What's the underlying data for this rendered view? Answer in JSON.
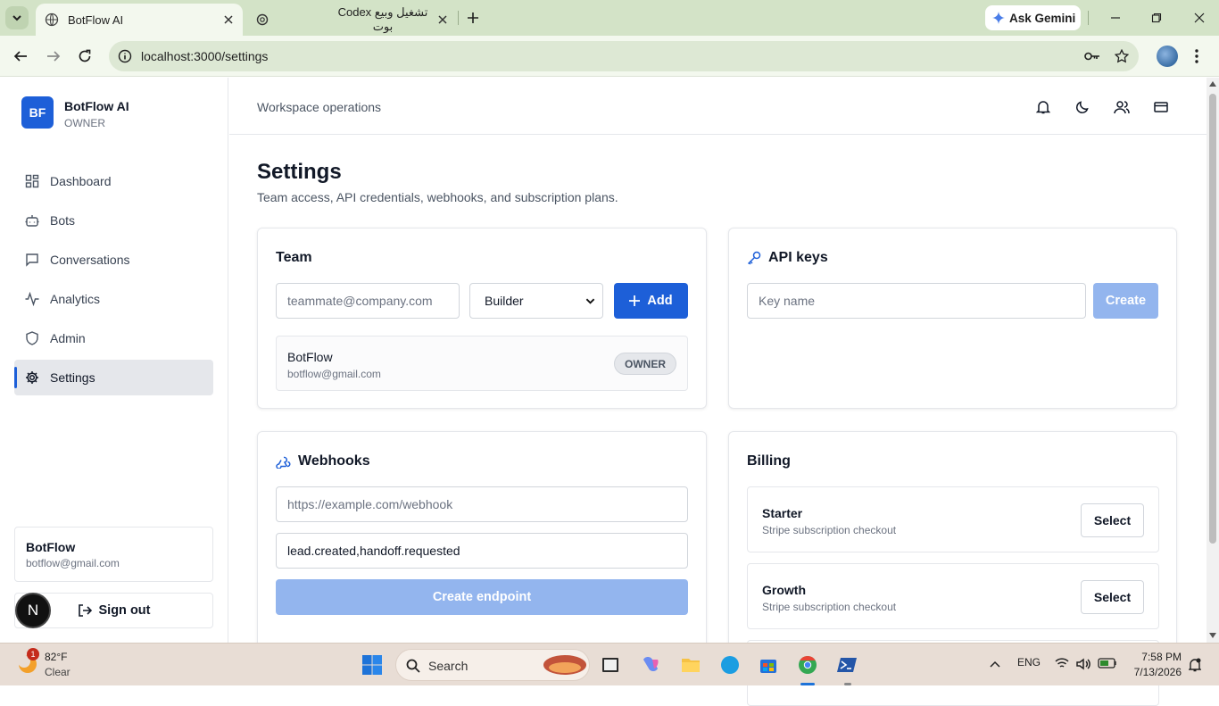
{
  "browser": {
    "active_tab": "BotFlow AI",
    "inactive_tab": "Codex تشغيل وبيع بوت",
    "gemini": "Ask Gemini",
    "url": "localhost:3000/settings"
  },
  "sidebar": {
    "logo": "BF",
    "brand": "BotFlow AI",
    "role": "OWNER",
    "items": [
      {
        "label": "Dashboard",
        "icon": "grid-icon"
      },
      {
        "label": "Bots",
        "icon": "bot-icon"
      },
      {
        "label": "Conversations",
        "icon": "message-icon"
      },
      {
        "label": "Analytics",
        "icon": "activity-icon"
      },
      {
        "label": "Admin",
        "icon": "shield-icon"
      },
      {
        "label": "Settings",
        "icon": "gear-icon",
        "selected": true
      }
    ],
    "user": {
      "name": "BotFlow",
      "email": "botflow@gmail.com"
    },
    "signout": "Sign out",
    "avatar_letter": "N"
  },
  "topbar": {
    "title": "Workspace operations"
  },
  "page": {
    "title": "Settings",
    "subtitle": "Team access, API credentials, webhooks, and subscription plans."
  },
  "team": {
    "title": "Team",
    "email_placeholder": "teammate@company.com",
    "role_value": "Builder",
    "add_label": "Add",
    "member": {
      "name": "BotFlow",
      "email": "botflow@gmail.com",
      "badge": "OWNER"
    }
  },
  "apikeys": {
    "title": "API keys",
    "name_placeholder": "Key name",
    "create_label": "Create"
  },
  "webhooks": {
    "title": "Webhooks",
    "url_placeholder": "https://example.com/webhook",
    "events_value": "lead.created,handoff.requested",
    "create_label": "Create endpoint"
  },
  "billing": {
    "title": "Billing",
    "plans": [
      {
        "name": "Starter",
        "desc": "Stripe subscription checkout",
        "button": "Select"
      },
      {
        "name": "Growth",
        "desc": "Stripe subscription checkout",
        "button": "Select"
      }
    ]
  },
  "taskbar": {
    "temp": "82°F",
    "weather": "Clear",
    "weather_badge": "1",
    "search": "Search",
    "lang": "ENG",
    "time": "7:58 PM",
    "date": "7/13/2026"
  },
  "colors": {
    "accent": "#1d5fd8",
    "accent_light": "#93b5ee",
    "chrome": "#d3e3c7"
  }
}
